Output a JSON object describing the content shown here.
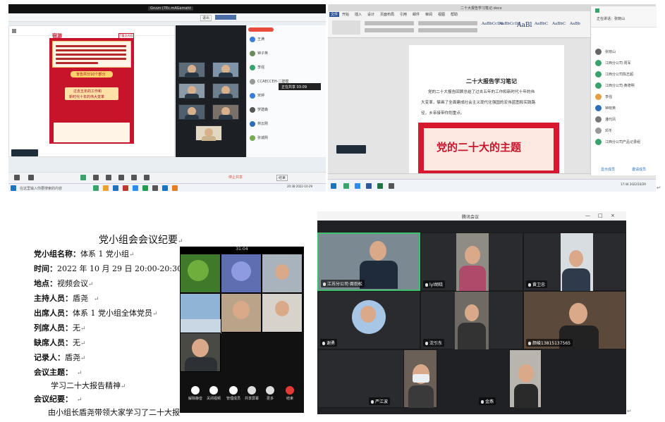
{
  "panel_a": {
    "window_title": "Gruvn (7Ec.mAGamaht",
    "minimize_btn": "退出",
    "slide_logo": "宿游",
    "slide_tag": "T重点内容",
    "slide_heading": "盲告共分10个部分",
    "slide_sub1": "过去五年的工作和",
    "slide_sub2": "新时代十年的伟大变革",
    "members": [
      "王满",
      "钟子英",
      "李强",
      "CCAECCEH-二建模",
      "宋婷",
      "罗建森",
      "林云刚",
      "张诚熙"
    ],
    "tooltip": "正在共享 03:09",
    "ctrl_labels": [
      "静音",
      "开启视频",
      "共享",
      "聊天",
      "成员",
      "录制",
      "应用",
      "结束会议"
    ],
    "share_btn": "停止共享",
    "end_btn": "结束",
    "taskbar_search": "在这里输入你要搜索的内容",
    "clock": "20:38 2022-10-29"
  },
  "panel_b": {
    "window_title": "二十大报告学习笔记.docx",
    "ribbon_tabs": [
      "文件",
      "开始",
      "插入",
      "设计",
      "页面布局",
      "引用",
      "邮件",
      "审阅",
      "视图",
      "帮助"
    ],
    "style_gallery": [
      "AaBbCcDd",
      "AaBbCcDd",
      "AaBl",
      "AaBbC",
      "AaBbC",
      "AaBb"
    ],
    "doc_title": "二十大报告学习笔记",
    "doc_para": [
      "党的二十大报告回顾总结了过去五年的工作和新时代十年的伟",
      "大变革，擘画了全面建成社会主义现代化强国的宏伟蓝图和实践路",
      "径，乡亲接带你划重点。"
    ],
    "banner_text": "党的二十大的主题",
    "chat_title": "正在讲话：张晓山",
    "chat_people": [
      "张晓山",
      "江西分公司·周军",
      "江西分公司陈志超",
      "江西分公司·黄德明",
      "李强",
      "钟晓英",
      "潘代凤",
      "邓冬",
      "江西分公司产品记录组"
    ],
    "footer_left": "显示成员",
    "footer_right": "邀请成员",
    "clock": "17:44 2022/10/29"
  },
  "minutes": {
    "title": "党小组会会议纪要",
    "group_label": "党小组名称：",
    "group_value": "体系 1 党小组",
    "time_label": "时间：",
    "time_value": "2022 年 10 月 29 日 20:00-20:30",
    "place_label": "地点：",
    "place_value": "视频会议",
    "host_label": "主持人员：",
    "host_value": "盾尧",
    "present_label": "出席人员：",
    "present_value": "体系 1 党小组全体党员",
    "attend_label": "列席人员：",
    "attend_value": "无",
    "absent_label": "缺席人员：",
    "absent_value": "无",
    "recorder_label": "记录人：",
    "recorder_value": "盾尧",
    "topic_label": "会议主题：",
    "topic_value": "学习二十大报告精神",
    "summary_label": "会议纪要：",
    "summary_value": "由小组长盾尧带领大家学习了二十大报",
    "return_mark": "↵"
  },
  "phone": {
    "timer": "31:04",
    "buttons": [
      "解除静音",
      "关闭视频",
      "管理成员",
      "共享屏幕",
      "更多",
      "结束"
    ]
  },
  "panel_d": {
    "window_title": "腾讯会议",
    "win_btns": [
      "—",
      "□",
      "×"
    ],
    "names": [
      "江苏分公司·周劲松",
      "lyl胡晓",
      "黄卫忠",
      "谢勇",
      "沈引东",
      "颜峻13815137565",
      "严江波",
      "金燕"
    ]
  }
}
